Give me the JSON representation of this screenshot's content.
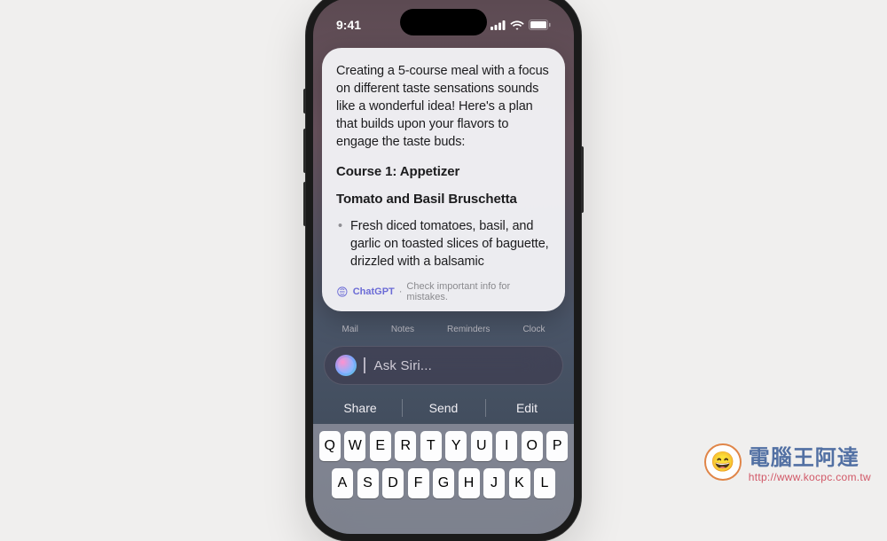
{
  "status": {
    "time": "9:41"
  },
  "card": {
    "intro": "Creating a 5-course meal with a focus on different taste sensations sounds like a wonderful idea! Here's a plan that builds upon your flavors to engage the taste buds:",
    "heading1": "Course 1: Appetizer",
    "heading2": "Tomato and Basil Bruschetta",
    "bullet1": "Fresh diced tomatoes, basil, and garlic on toasted slices of baguette, drizzled with a balsamic",
    "source": "ChatGPT",
    "disclaimer": "Check important info for mistakes."
  },
  "apps": {
    "a1": "Mail",
    "a2": "Notes",
    "a3": "Reminders",
    "a4": "Clock"
  },
  "siri": {
    "placeholder": "Ask Siri..."
  },
  "suggestions": {
    "s1": "Share",
    "s2": "Send",
    "s3": "Edit"
  },
  "keyboard": {
    "row1": [
      "Q",
      "W",
      "E",
      "R",
      "T",
      "Y",
      "U",
      "I",
      "O",
      "P"
    ],
    "row2": [
      "A",
      "S",
      "D",
      "F",
      "G",
      "H",
      "J",
      "K",
      "L"
    ]
  },
  "watermark": {
    "title": "電腦王阿達",
    "url": "http://www.kocpc.com.tw"
  }
}
